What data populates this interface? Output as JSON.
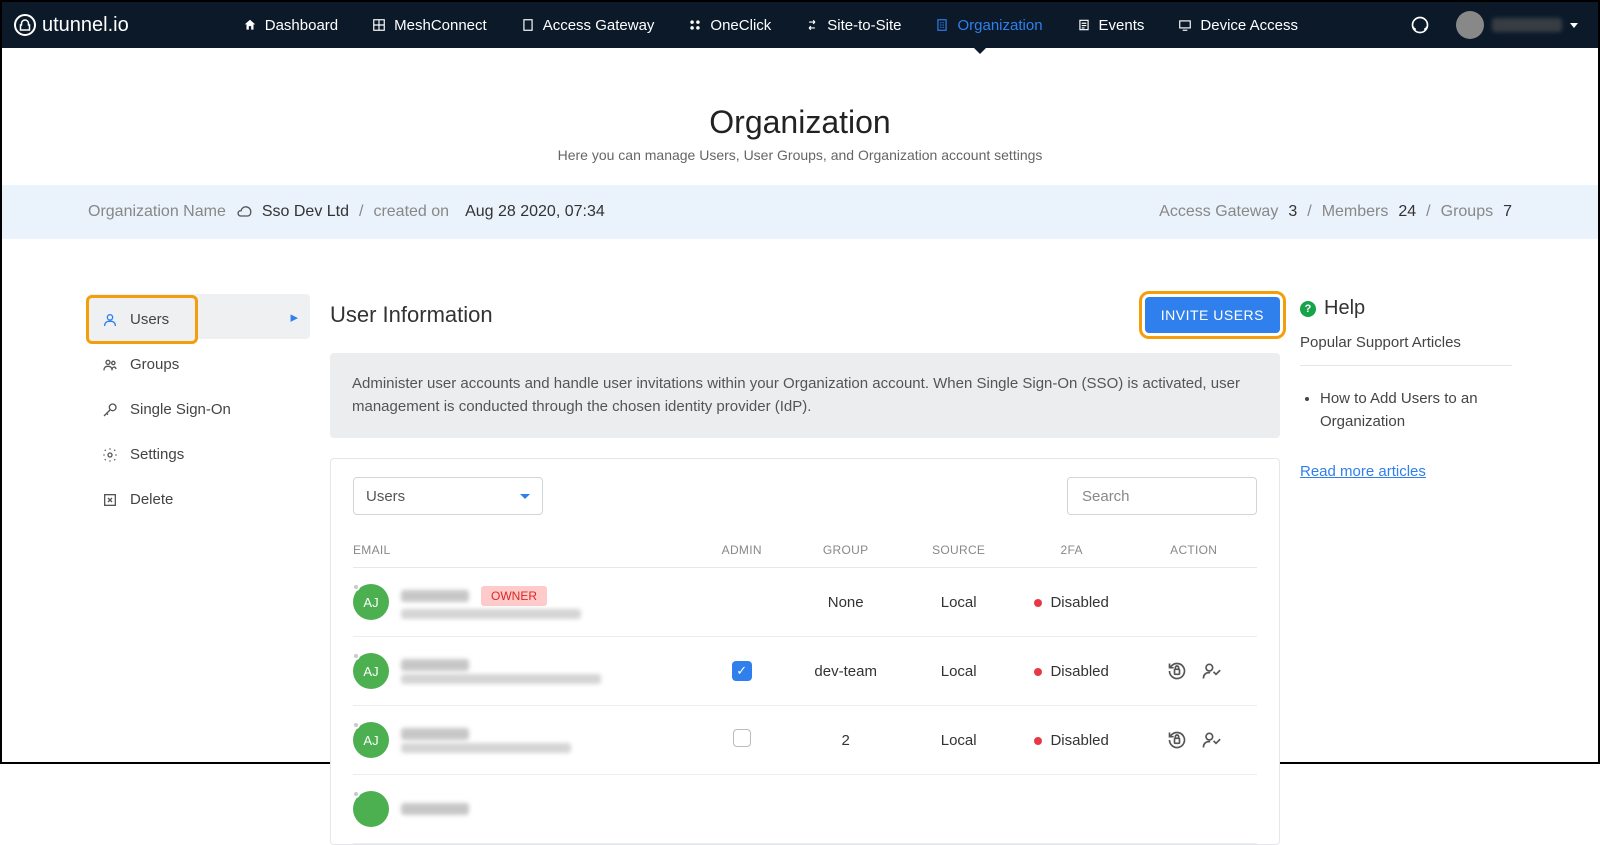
{
  "brand": "utunnel.io",
  "nav": {
    "items": [
      {
        "label": "Dashboard"
      },
      {
        "label": "MeshConnect"
      },
      {
        "label": "Access Gateway"
      },
      {
        "label": "OneClick"
      },
      {
        "label": "Site-to-Site"
      },
      {
        "label": "Organization"
      },
      {
        "label": "Events"
      },
      {
        "label": "Device Access"
      }
    ]
  },
  "page": {
    "title": "Organization",
    "subtitle": "Here you can manage Users, User Groups, and Organization account settings"
  },
  "info_bar": {
    "org_label": "Organization Name",
    "org_name": "Sso Dev Ltd",
    "sep": "/",
    "created_label": "created on",
    "created_value": "Aug 28 2020, 07:34",
    "gw_label": "Access Gateway",
    "gw_count": "3",
    "members_label": "Members",
    "members_count": "24",
    "groups_label": "Groups",
    "groups_count": "7"
  },
  "sidebar": {
    "users": "Users",
    "groups": "Groups",
    "sso": "Single Sign-On",
    "settings": "Settings",
    "delete": "Delete"
  },
  "content": {
    "title": "User Information",
    "invite_btn": "INVITE USERS",
    "description": "Administer user accounts and handle user invitations within your Organization account. When Single Sign-On (SSO) is activated, user management is conducted through the chosen identity provider (IdP).",
    "select_value": "Users",
    "search_placeholder": "Search"
  },
  "table": {
    "headers": {
      "email": "EMAIL",
      "admin": "ADMIN",
      "group": "GROUP",
      "source": "SOURCE",
      "twofa": "2FA",
      "action": "ACTION"
    },
    "rows": [
      {
        "initials": "AJ",
        "owner": true,
        "owner_label": "OWNER",
        "admin": null,
        "group": "None",
        "source": "Local",
        "twofa": "Disabled",
        "actions": false
      },
      {
        "initials": "AJ",
        "owner": false,
        "admin": true,
        "group": "dev-team",
        "source": "Local",
        "twofa": "Disabled",
        "actions": true
      },
      {
        "initials": "AJ",
        "owner": false,
        "admin": false,
        "group": "2",
        "source": "Local",
        "twofa": "Disabled",
        "actions": true
      }
    ]
  },
  "help": {
    "title": "Help",
    "subtitle": "Popular Support Articles",
    "article": "How to Add Users to an Organization",
    "read_more": "Read more articles"
  }
}
